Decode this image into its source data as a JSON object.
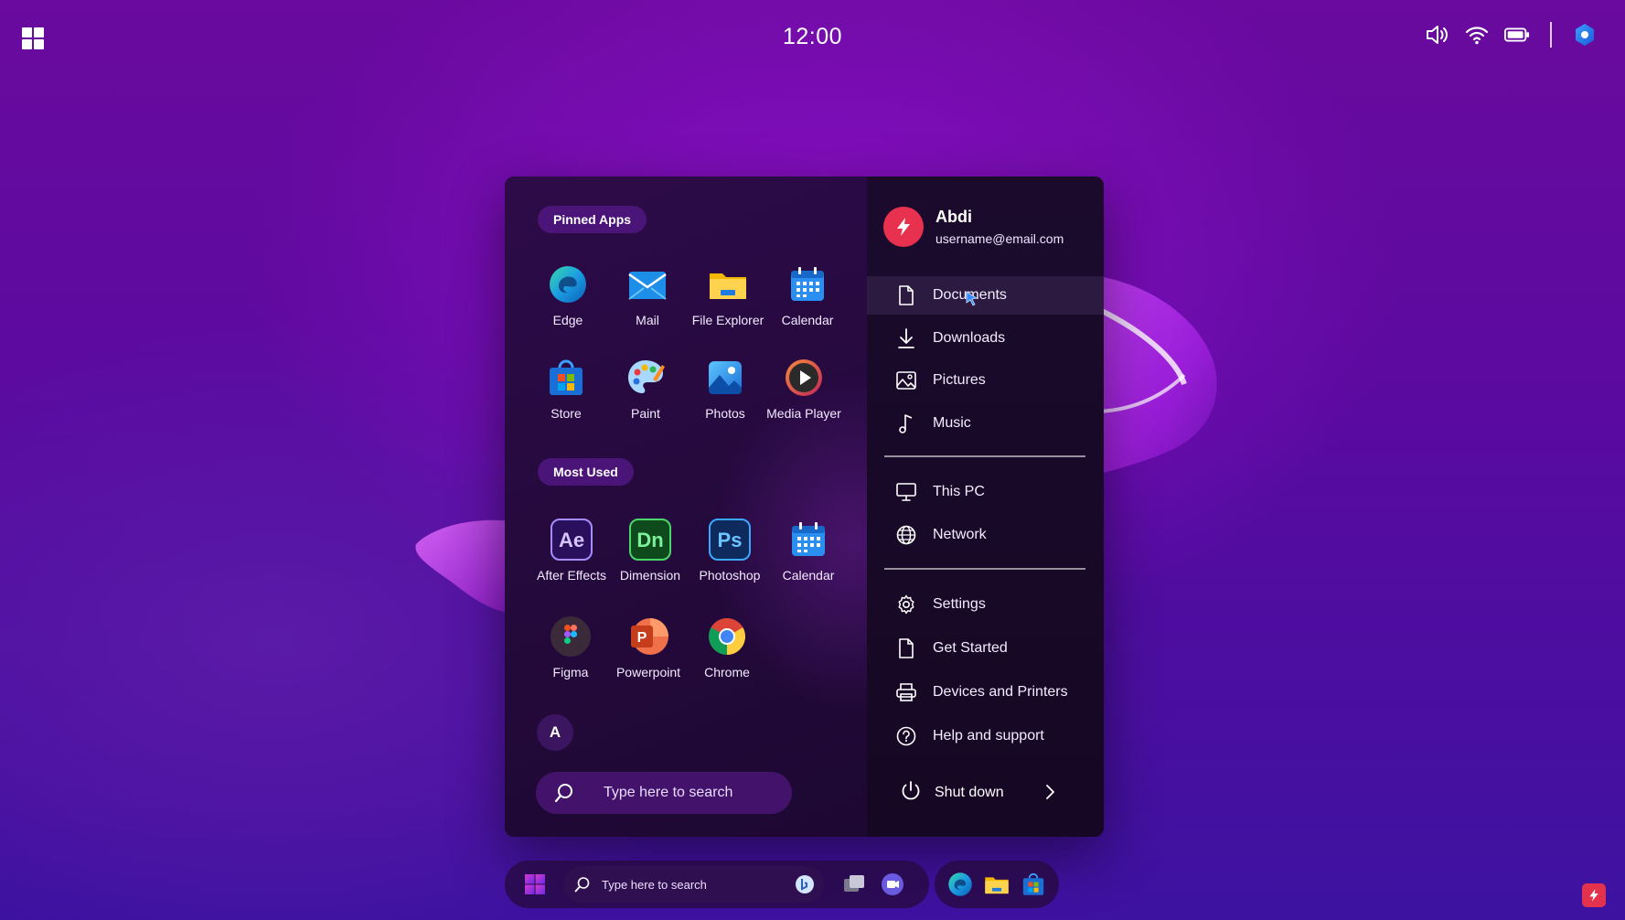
{
  "topbar": {
    "time": "12:00",
    "tray_icons": [
      "volume-icon",
      "wifi-icon",
      "battery-icon",
      "copilot-icon"
    ]
  },
  "start_menu": {
    "pinned_label": "Pinned Apps",
    "pinned_apps": [
      {
        "label": "Edge",
        "icon": "edge-icon"
      },
      {
        "label": "Mail",
        "icon": "mail-icon"
      },
      {
        "label": "File Explorer",
        "icon": "folder-icon"
      },
      {
        "label": "Calendar",
        "icon": "calendar-icon"
      },
      {
        "label": "Store",
        "icon": "store-icon"
      },
      {
        "label": "Paint",
        "icon": "paint-icon"
      },
      {
        "label": "Photos",
        "icon": "photos-icon"
      },
      {
        "label": "Media Player",
        "icon": "play-icon"
      }
    ],
    "most_used_label": "Most Used",
    "most_used_apps": [
      {
        "label": "After Effects",
        "icon": "after-effects-icon",
        "abbr": "Ae"
      },
      {
        "label": "Dimension",
        "icon": "dimension-icon",
        "abbr": "Dn"
      },
      {
        "label": "Photoshop",
        "icon": "photoshop-icon",
        "abbr": "Ps"
      },
      {
        "label": "Calendar",
        "icon": "calendar-icon"
      },
      {
        "label": "Figma",
        "icon": "figma-icon"
      },
      {
        "label": "Powerpoint",
        "icon": "powerpoint-icon",
        "abbr": "P"
      },
      {
        "label": "Chrome",
        "icon": "chrome-icon"
      }
    ],
    "alpha_letter": "A",
    "search_placeholder": "Type here to search",
    "user": {
      "name": "Abdi",
      "email": "username@email.com"
    },
    "links": [
      {
        "label": "Documents",
        "icon": "document-icon",
        "active": true
      },
      {
        "label": "Downloads",
        "icon": "download-icon"
      },
      {
        "label": "Pictures",
        "icon": "image-icon"
      },
      {
        "label": "Music",
        "icon": "music-icon"
      },
      {
        "label": "This PC",
        "icon": "monitor-icon"
      },
      {
        "label": "Network",
        "icon": "globe-icon"
      },
      {
        "label": "Settings",
        "icon": "gear-icon"
      },
      {
        "label": "Get Started",
        "icon": "document-icon"
      },
      {
        "label": "Devices and Printers",
        "icon": "printer-icon"
      },
      {
        "label": "Help and support",
        "icon": "help-icon"
      }
    ],
    "shutdown_label": "Shut down"
  },
  "taskbar": {
    "search_placeholder": "Type here to search"
  },
  "colors": {
    "accent_pill": "#4a1478",
    "avatar": "#e8314f",
    "ae": "#2a0f5c",
    "dn": "#0f4a1c",
    "ps": "#0f2a5c"
  }
}
